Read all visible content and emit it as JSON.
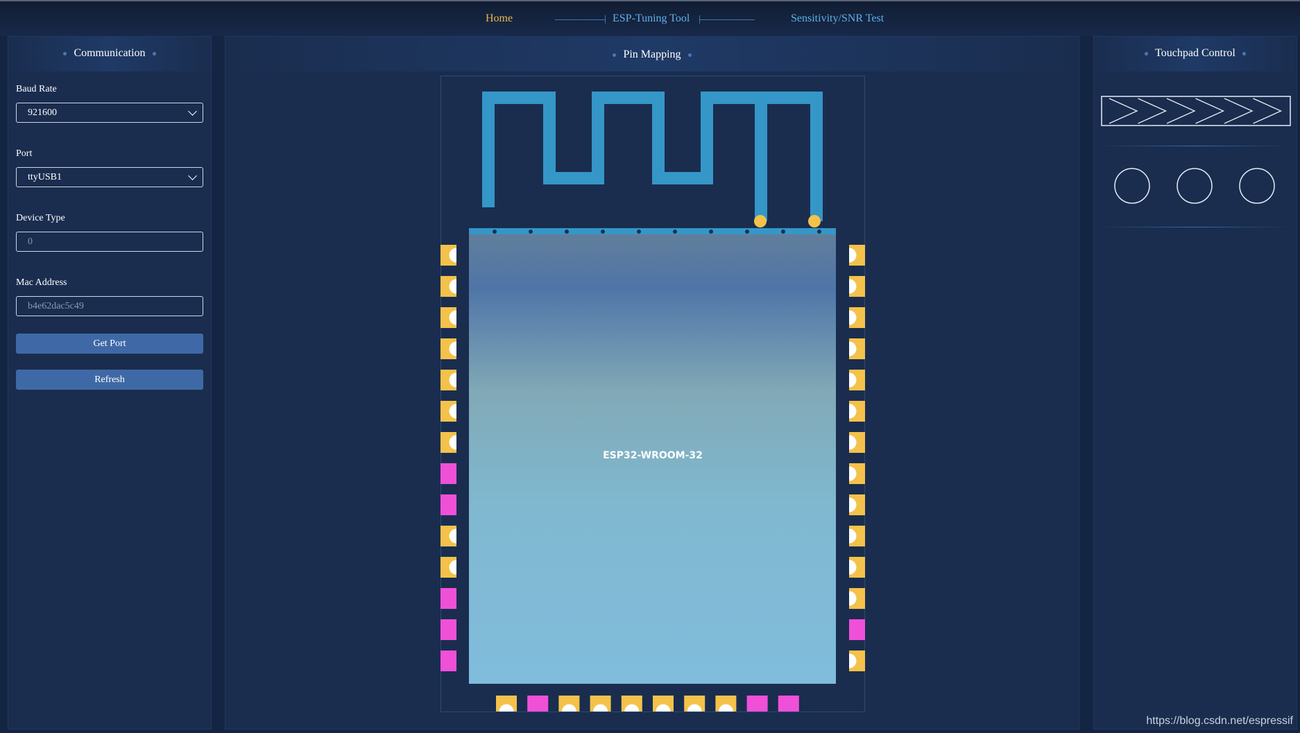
{
  "nav": {
    "home": "Home",
    "title": "ESP-Tuning Tool",
    "snr": "Sensitivity/SNR Test"
  },
  "communication": {
    "title": "Communication",
    "baud_label": "Baud Rate",
    "baud_value": "921600",
    "port_label": "Port",
    "port_value": "ttyUSB1",
    "device_type_label": "Device Type",
    "device_type_placeholder": "0",
    "mac_label": "Mac Address",
    "mac_placeholder": "b4e62dac5c49",
    "get_port": "Get Port",
    "refresh": "Refresh"
  },
  "pin_mapping": {
    "title": "Pin Mapping",
    "chip_name": "ESP32-WROOM-32",
    "left_pins": [
      "gold",
      "gold",
      "gold",
      "gold",
      "gold",
      "gold",
      "gold",
      "magenta",
      "magenta",
      "gold",
      "gold",
      "magenta",
      "magenta",
      "magenta"
    ],
    "right_pins": [
      "gold",
      "gold",
      "gold",
      "gold",
      "gold",
      "gold",
      "gold",
      "gold",
      "gold",
      "gold",
      "gold",
      "gold",
      "magenta",
      "gold"
    ],
    "bottom_pins": [
      "gold",
      "magenta",
      "gold",
      "gold",
      "gold",
      "gold",
      "gold",
      "gold",
      "magenta",
      "magenta"
    ]
  },
  "touchpad": {
    "title": "Touchpad Control",
    "slider_arrows": 6,
    "buttons": 3
  },
  "colors": {
    "gold": "#f4c24a",
    "magenta": "#f050d8",
    "antenna": "#3596c8",
    "accent": "#3f69a6"
  },
  "watermark": "https://blog.csdn.net/espressif"
}
